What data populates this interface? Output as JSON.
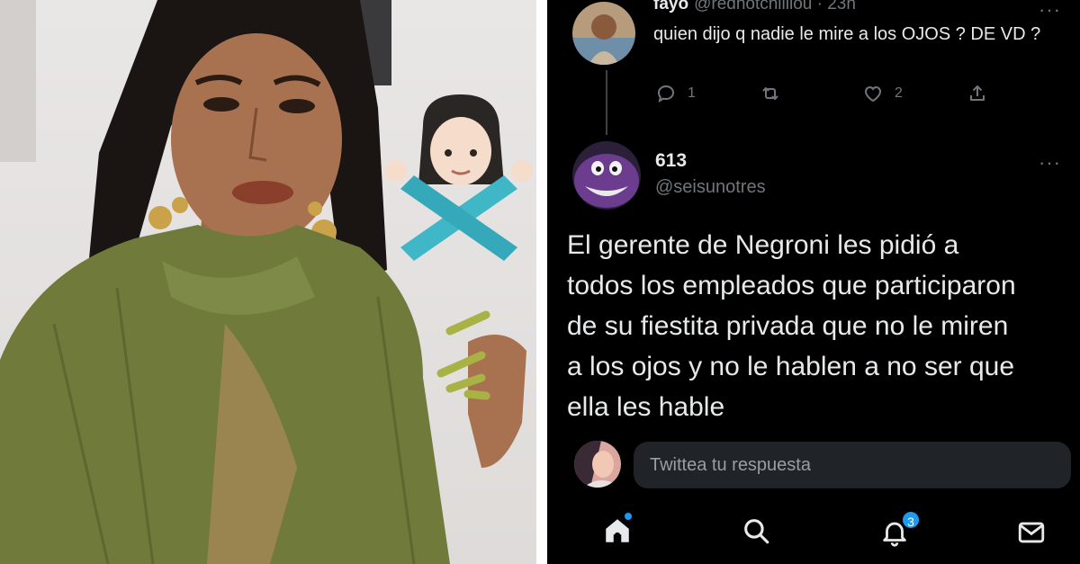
{
  "tweets": {
    "parent": {
      "display_name": "fayo",
      "meta": "@redhotchilliou · 23h",
      "text": "quien dijo q nadie le mire a los OJOS ? DE VD ?",
      "reply_count": "1",
      "like_count": "2"
    },
    "main": {
      "display_name": "613",
      "handle": "@seisunotres",
      "more_label": "···",
      "lines": [
        "El gerente de Negroni les pidió a",
        "todos los empleados que participaron",
        "de su fiestita privada que no le miren",
        "a los ojos y no le hablen a no ser que",
        "ella les hable"
      ]
    }
  },
  "reply": {
    "placeholder": "Twittea tu respuesta"
  },
  "bottom_nav": {
    "items": [
      "home-icon",
      "search-icon",
      "notifications-icon",
      "messages-icon"
    ],
    "notification_count": "3"
  },
  "colors": {
    "background": "#000000",
    "text_primary": "#e7e9ea",
    "text_secondary": "#71767b",
    "accent": "#1d9bf0",
    "reply_box": "#202327"
  }
}
